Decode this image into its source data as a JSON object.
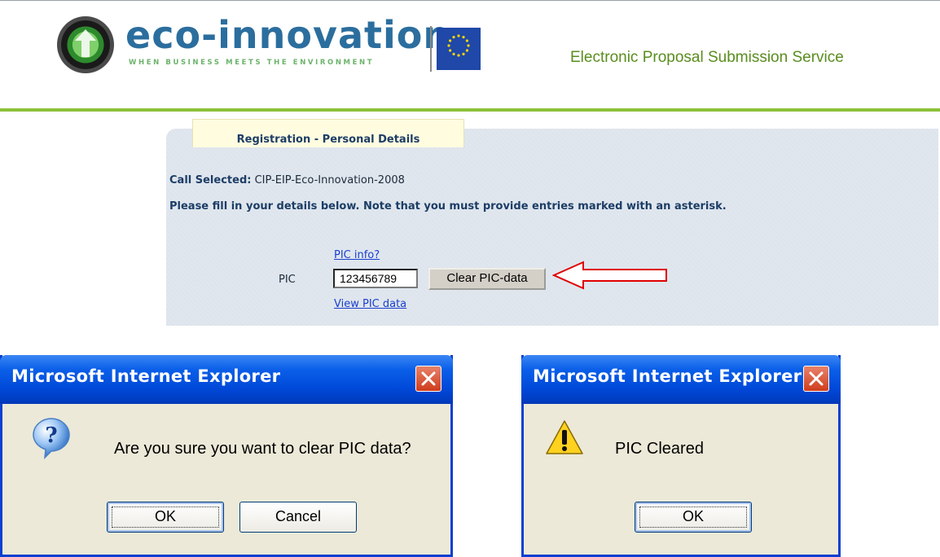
{
  "header": {
    "logo_text": "eco-innovation",
    "logo_tagline": "WHEN BUSINESS MEETS THE ENVIRONMENT",
    "service_title": "Electronic Proposal Submission Service"
  },
  "panel": {
    "tab_label": "Registration - Personal Details",
    "call_label": "Call Selected:",
    "call_value": "CIP-EIP-Eco-Innovation-2008",
    "instruction": "Please fill in your details below. Note that you must provide entries marked with an asterisk."
  },
  "pic": {
    "info_link": "PIC info?",
    "label": "PIC",
    "value": "123456789",
    "clear_button": "Clear PIC-data",
    "view_link": "View PIC data"
  },
  "confirm_dialog": {
    "title": "Microsoft Internet Explorer",
    "message": "Are you sure you want to clear PIC data?",
    "ok_label": "OK",
    "cancel_label": "Cancel",
    "icon": "question-icon"
  },
  "alert_dialog": {
    "title": "Microsoft Internet Explorer",
    "message": "PIC Cleared",
    "ok_label": "OK",
    "icon": "warning-icon"
  },
  "colors": {
    "accent_green": "#8dc13b",
    "panel_bg": "#dde4ec",
    "xp_title_blue": "#0a5fe8",
    "annotation_red": "#e00000"
  }
}
